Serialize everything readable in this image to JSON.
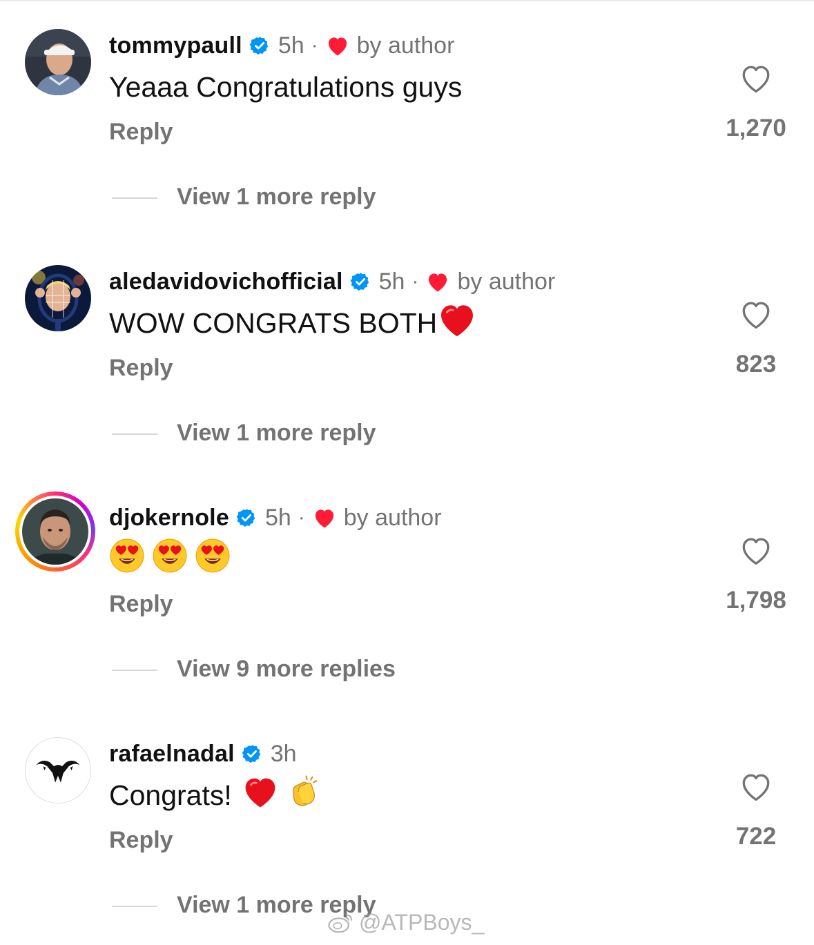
{
  "comments": [
    {
      "username": "tommypaull",
      "time": "5h",
      "separator": "·",
      "liked_by_author": "by author",
      "text": "Yeaaa Congratulations guys",
      "reply_label": "Reply",
      "likes": "1,270",
      "more_replies": "View 1 more reply"
    },
    {
      "username": "aledavidovichofficial",
      "time": "5h",
      "separator": "·",
      "liked_by_author": "by author",
      "text": "WOW CONGRATS BOTH",
      "reply_label": "Reply",
      "likes": "823",
      "more_replies": "View 1 more reply"
    },
    {
      "username": "djokernole",
      "time": "5h",
      "separator": "·",
      "liked_by_author": "by author",
      "text": "",
      "reply_label": "Reply",
      "likes": "1,798",
      "more_replies": "View 9 more replies"
    },
    {
      "username": "rafaelnadal",
      "time": "3h",
      "text": "Congrats!",
      "reply_label": "Reply",
      "likes": "722",
      "more_replies": "View 1 more reply"
    }
  ],
  "watermark": "@ATPBoys_",
  "colors": {
    "verified": "#0095f6",
    "heart": "#ff1b35",
    "muted_text": "#737373"
  },
  "icons": {
    "verified": "verified-badge-icon",
    "like": "heart-outline-icon",
    "author_like": "heart-filled-icon"
  }
}
